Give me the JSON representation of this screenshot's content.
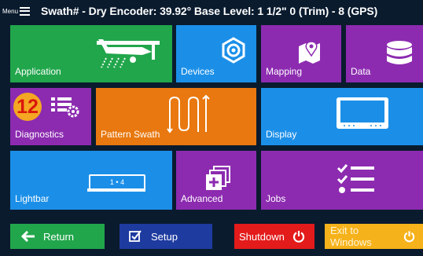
{
  "header": {
    "menu_label": "Menu",
    "status": "Swath# -   Dry Encoder: 39.92°   Base Level: 1 1/2\"  0 (Trim) - 8 (GPS)"
  },
  "tiles": {
    "application": {
      "label": "Application",
      "color": "#21a64b",
      "icon": "crop-duster-plane-icon"
    },
    "devices": {
      "label": "Devices",
      "color": "#1b8fe8",
      "icon": "hexagon-gear-icon"
    },
    "mapping": {
      "label": "Mapping",
      "color": "#8c2bb0",
      "icon": "map-pin-icon"
    },
    "data": {
      "label": "Data",
      "color": "#8c2bb0",
      "icon": "database-icon"
    },
    "diagnostics": {
      "label": "Diagnostics",
      "color": "#8c2bb0",
      "icon": "list-gear-icon",
      "badge": "12"
    },
    "pattern_swath": {
      "label": "Pattern Swath",
      "color": "#e8780f",
      "icon": "serpentine-arrows-icon"
    },
    "display": {
      "label": "Display",
      "color": "#1b8fe8",
      "icon": "monitor-icon"
    },
    "lightbar": {
      "label": "Lightbar",
      "color": "#1b8fe8",
      "icon": "lightbar-icon",
      "lightbar_text": "1  •  4"
    },
    "advanced": {
      "label": "Advanced",
      "color": "#8c2bb0",
      "icon": "layered-plus-icon"
    },
    "jobs": {
      "label": "Jobs",
      "color": "#8c2bb0",
      "icon": "checklist-icon"
    }
  },
  "buttons": {
    "return": {
      "label": "Return",
      "color": "#21a64b",
      "icon": "arrow-left-icon"
    },
    "setup": {
      "label": "Setup",
      "color": "#1e3ba0",
      "icon": "checkbox-icon"
    },
    "shutdown": {
      "label": "Shutdown",
      "color": "#e31b1b",
      "icon": "power-icon"
    },
    "exit": {
      "label": "Exit to Windows",
      "color": "#f6b21b",
      "icon": "power-icon"
    }
  }
}
